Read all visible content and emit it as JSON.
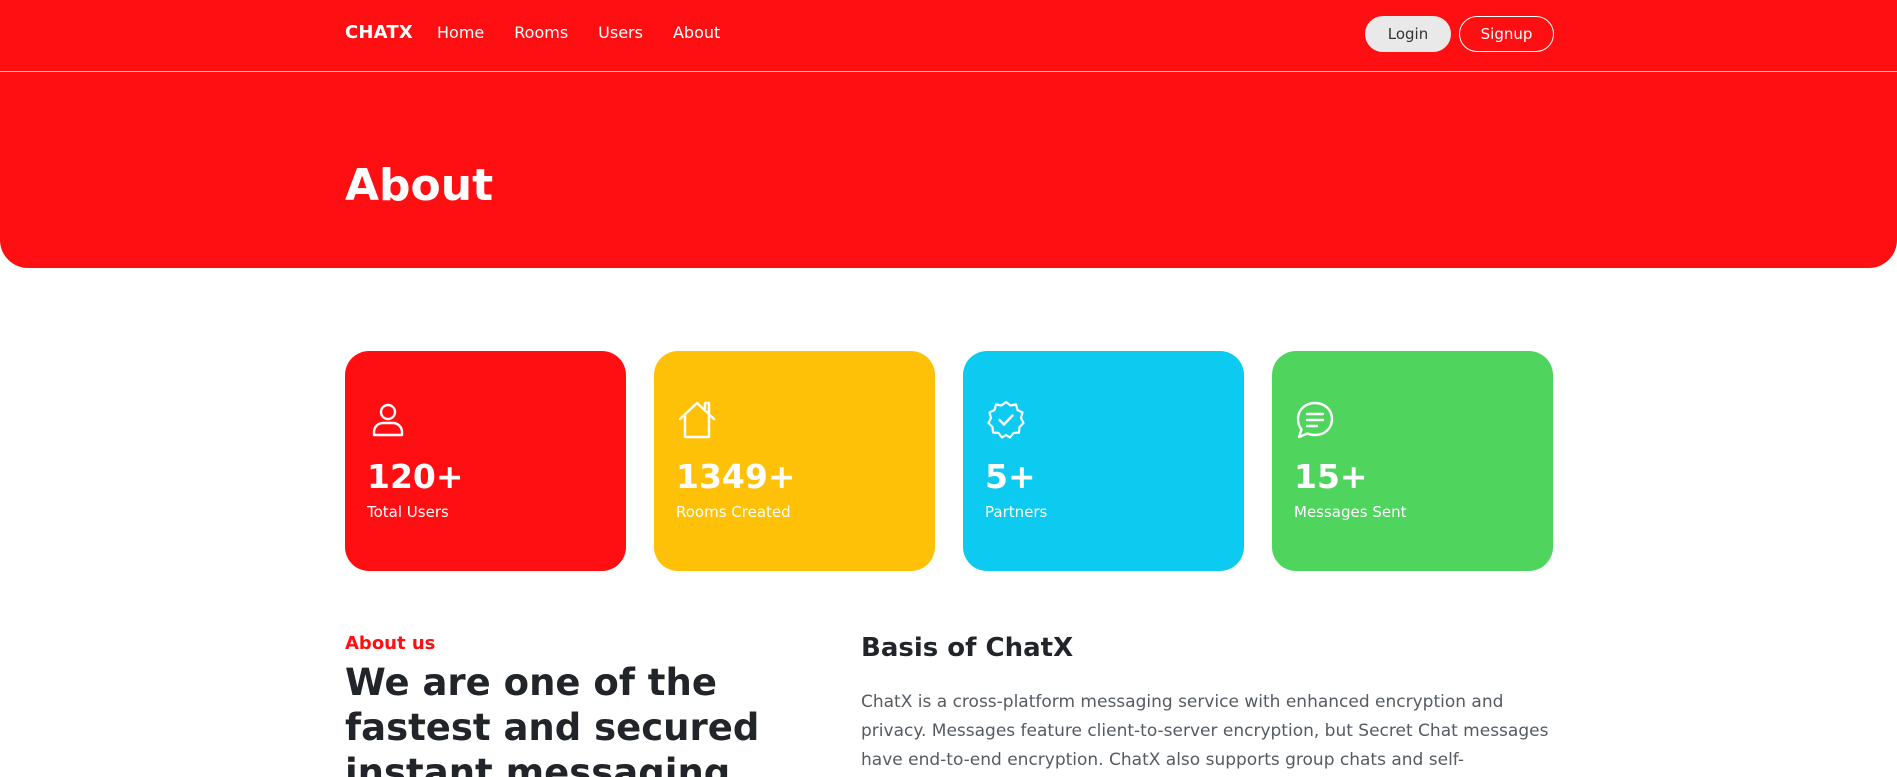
{
  "nav": {
    "brand": "CHATX",
    "links": [
      "Home",
      "Rooms",
      "Users",
      "About"
    ],
    "login_label": "Login",
    "signup_label": "Signup"
  },
  "hero": {
    "title": "About"
  },
  "stats": [
    {
      "icon": "user-icon",
      "value": "120+",
      "label": "Total Users",
      "color": "#ff0f11"
    },
    {
      "icon": "house-icon",
      "value": "1349+",
      "label": "Rooms Created",
      "color": "#ffc107"
    },
    {
      "icon": "verified-badge-icon",
      "value": "5+",
      "label": "Partners",
      "color": "#0dcaf0"
    },
    {
      "icon": "chat-bubble-icon",
      "value": "15+",
      "label": "Messages Sent",
      "color": "#4fd45e"
    }
  ],
  "about": {
    "eyebrow": "About us",
    "heading": "We are one of the fastest and secured instant messaging",
    "basis_title": "Basis of ChatX",
    "basis_text": "ChatX is a cross-platform messaging service with enhanced encryption and privacy. Messages feature client-to-server encryption, but Secret Chat messages have end-to-end encryption. ChatX also supports group chats and self-"
  },
  "colors": {
    "accent": "#ff0f11",
    "yellow": "#ffc107",
    "cyan": "#0dcaf0",
    "green": "#4fd45e"
  }
}
